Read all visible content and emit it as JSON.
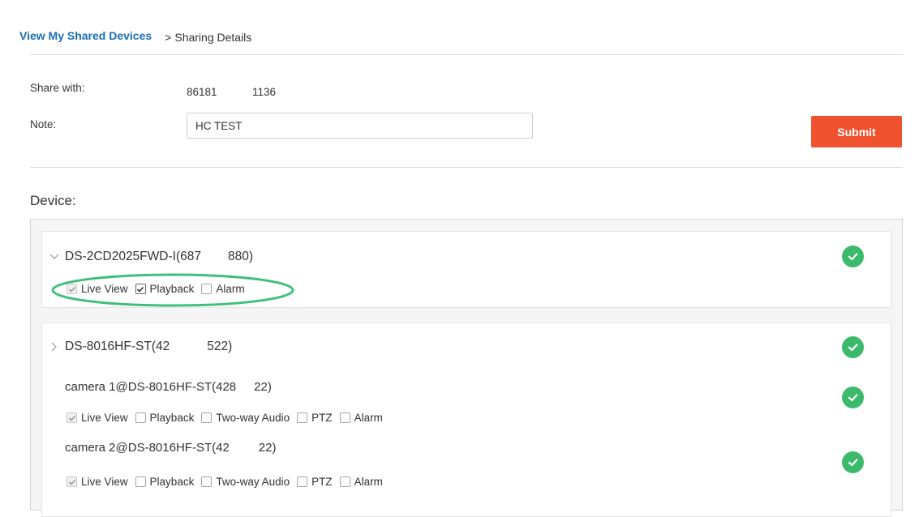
{
  "breadcrumb": {
    "root_label": "View My Shared Devices",
    "separator": ">",
    "current_label": "Sharing Details"
  },
  "form": {
    "share_with_label": "Share with:",
    "share_with_value_part1": "86181",
    "share_with_value_part2": "1136",
    "note_label": "Note:",
    "note_value": "HC TEST",
    "submit_label": "Submit"
  },
  "device_section": {
    "heading": "Device:"
  },
  "devices": [
    {
      "name_part1": "DS-2CD2025FWD-I(687",
      "name_part2": "880)",
      "permissions": [
        {
          "label": "Live View",
          "checked": true,
          "disabled": true
        },
        {
          "label": "Playback",
          "checked": true,
          "disabled": false
        },
        {
          "label": "Alarm",
          "checked": false,
          "disabled": false
        }
      ]
    },
    {
      "name_part1": "DS-8016HF-ST(42&#8204;",
      "name": "DS-8016HF-ST(42",
      "name_part2": "522)",
      "cameras": [
        {
          "name_part1": "camera 1@DS-8016HF-ST(428",
          "name_part2": "22)",
          "permissions": [
            {
              "label": "Live View",
              "checked": true,
              "disabled": true
            },
            {
              "label": "Playback",
              "checked": false,
              "disabled": false
            },
            {
              "label": "Two-way Audio",
              "checked": false,
              "disabled": false
            },
            {
              "label": "PTZ",
              "checked": false,
              "disabled": false
            },
            {
              "label": "Alarm",
              "checked": false,
              "disabled": false
            }
          ]
        },
        {
          "name_part1": "camera 2@DS-8016HF-ST(42",
          "name_part2": "22)",
          "permissions": [
            {
              "label": "Live View",
              "checked": true,
              "disabled": true
            },
            {
              "label": "Playback",
              "checked": false,
              "disabled": false
            },
            {
              "label": "Two-way Audio",
              "checked": false,
              "disabled": false
            },
            {
              "label": "PTZ",
              "checked": false,
              "disabled": false
            },
            {
              "label": "Alarm",
              "checked": false,
              "disabled": false
            }
          ]
        }
      ]
    }
  ],
  "colors": {
    "accent_blue": "#1a6fb5",
    "submit_orange": "#f0522f",
    "status_green": "#3cba6c",
    "annotation_green": "#3fc07a"
  }
}
